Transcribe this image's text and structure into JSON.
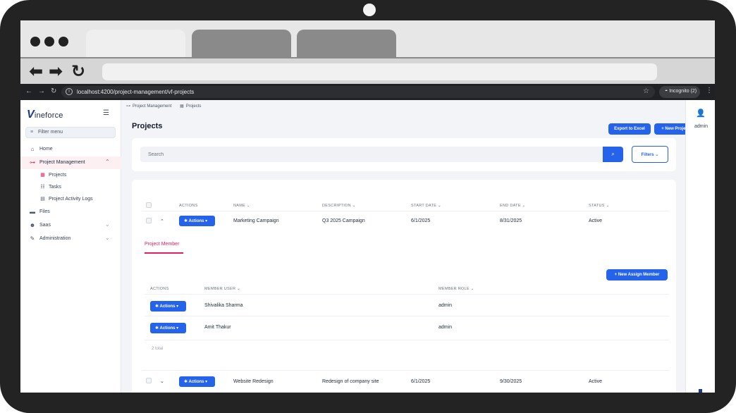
{
  "browser": {
    "url": "localhost:4200/project-management/vf-projects",
    "incognito_label": "Incognito (2)"
  },
  "sidebar": {
    "logo_text": "ineforce",
    "logo_mark": "V",
    "filter_placeholder": "Filter menu",
    "items": [
      {
        "label": "Home",
        "icon": "home-icon"
      },
      {
        "label": "Project Management",
        "icon": "sitemap-icon"
      },
      {
        "label": "Files",
        "icon": "folder-icon"
      },
      {
        "label": "Saas",
        "icon": "users-icon"
      },
      {
        "label": "Administration",
        "icon": "wrench-icon"
      }
    ],
    "sub_items": [
      {
        "label": "Projects",
        "icon": "table-icon"
      },
      {
        "label": "Tasks",
        "icon": "list-icon"
      },
      {
        "label": "Project Activity Logs",
        "icon": "file-icon"
      }
    ]
  },
  "breadcrumb": {
    "parent": "Project Management",
    "current": "Projects"
  },
  "page": {
    "title": "Projects",
    "export_label": "Export to Excel",
    "new_project_label": "New Project",
    "search_placeholder": "Search",
    "filters_label": "Filters"
  },
  "table": {
    "headers": [
      "ACTIONS",
      "NAME",
      "DESCRIPTION",
      "START DATE",
      "END DATE",
      "STATUS"
    ],
    "rows": [
      {
        "actions": "Actions",
        "name": "Marketing Campaign",
        "description": "Q3 2025 Campaign",
        "start": "6/1/2025",
        "end": "8/31/2025",
        "status": "Active"
      },
      {
        "actions": "Actions",
        "name": "Website Redesign",
        "description": "Redesign of company site",
        "start": "6/1/2025",
        "end": "9/30/2025",
        "status": "Active"
      }
    ]
  },
  "detail": {
    "tab_label": "Project Member",
    "new_assign_label": "New Assign Member",
    "headers": [
      "ACTIONS",
      "MEMBER USER",
      "MEMBER ROLE"
    ],
    "rows": [
      {
        "actions": "Actions",
        "user": "Shivalika Sharma",
        "role": "admin"
      },
      {
        "actions": "Actions",
        "user": "Amit Thakur",
        "role": "admin"
      }
    ],
    "total": "2 total"
  },
  "user_panel": {
    "label": "admin"
  },
  "colors": {
    "primary": "#2563eb",
    "accent": "#e11d63"
  }
}
